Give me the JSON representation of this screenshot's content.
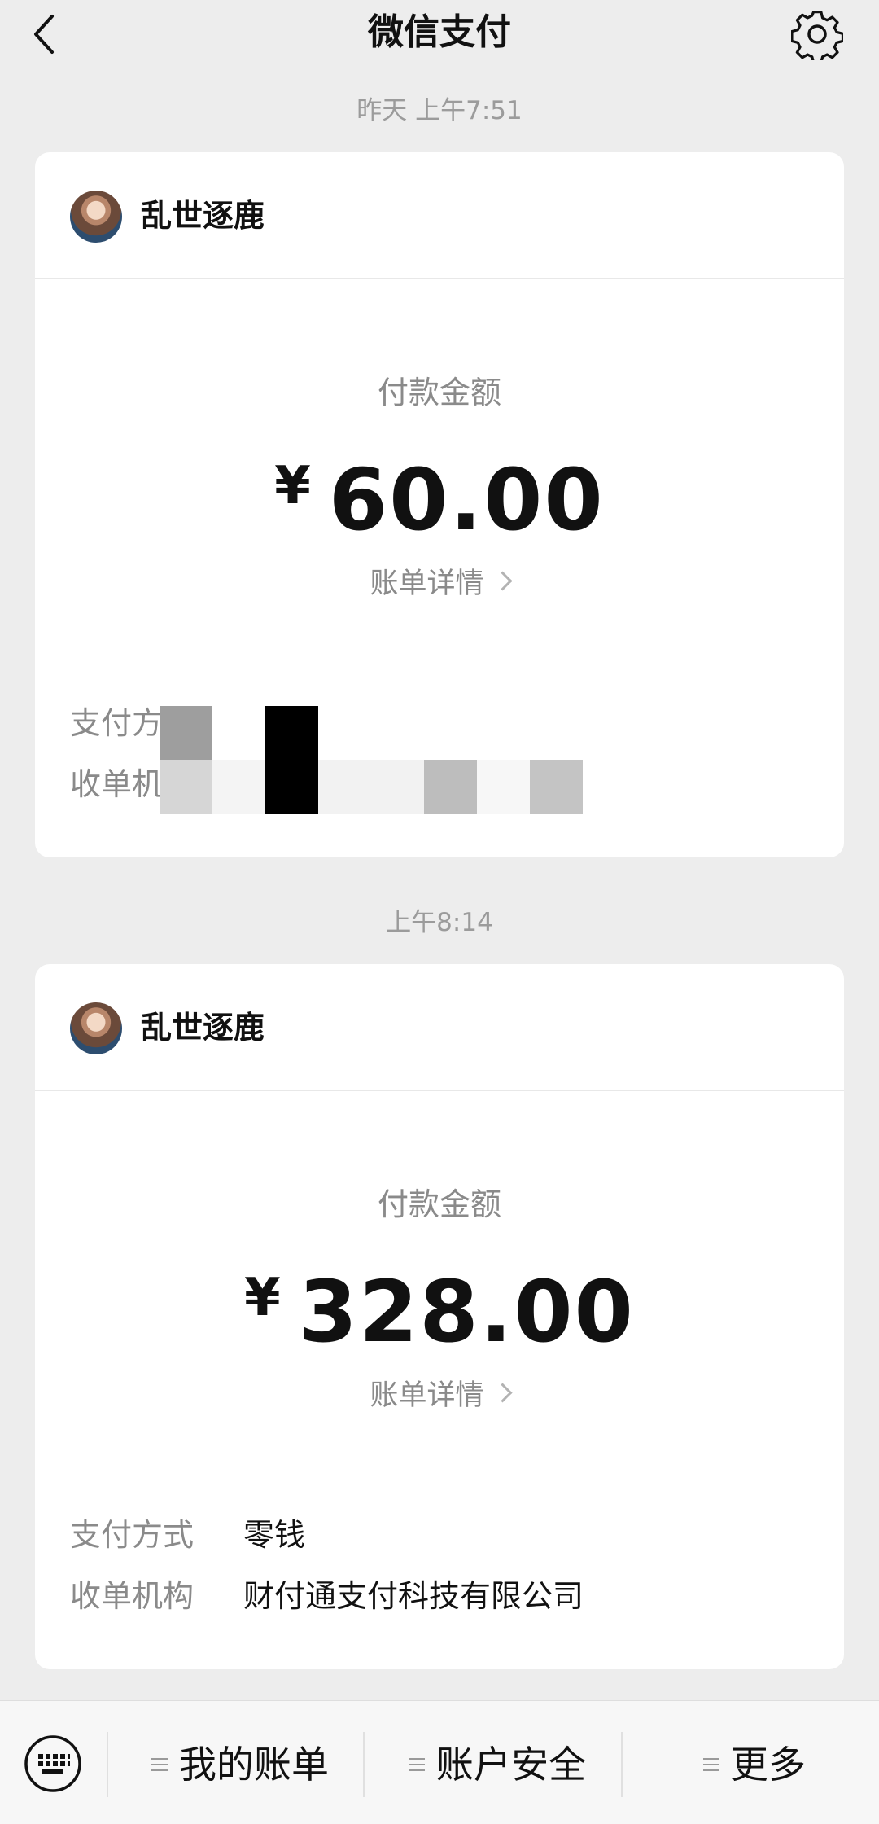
{
  "header": {
    "title": "微信支付",
    "back_icon": "chevron-left-icon",
    "settings_icon": "gear-icon"
  },
  "messages": [
    {
      "time": "昨天 上午7:51",
      "merchant": "乱世逐鹿",
      "pay_label": "付款金额",
      "currency": "¥",
      "amount": "60.00",
      "detail_label": "账单详情",
      "rows": [
        {
          "label": "支付方式",
          "value": ""
        },
        {
          "label": "收单机构",
          "value": ""
        }
      ]
    },
    {
      "time": "上午8:14",
      "merchant": "乱世逐鹿",
      "pay_label": "付款金额",
      "currency": "¥",
      "amount": "328.00",
      "detail_label": "账单详情",
      "rows": [
        {
          "label": "支付方式",
          "value": "零钱"
        },
        {
          "label": "收单机构",
          "value": "财付通支付科技有限公司"
        }
      ]
    }
  ],
  "bottom_bar": {
    "keyboard_icon": "keyboard-icon",
    "items": [
      {
        "label": "我的账单",
        "icon": "menu-lines-icon"
      },
      {
        "label": "账户安全",
        "icon": "menu-lines-icon"
      },
      {
        "label": "更多",
        "icon": "menu-lines-icon"
      }
    ]
  },
  "colors": {
    "background": "#ededed",
    "card": "#ffffff",
    "secondary_text": "#8a8a8a",
    "primary_text": "#111111"
  }
}
